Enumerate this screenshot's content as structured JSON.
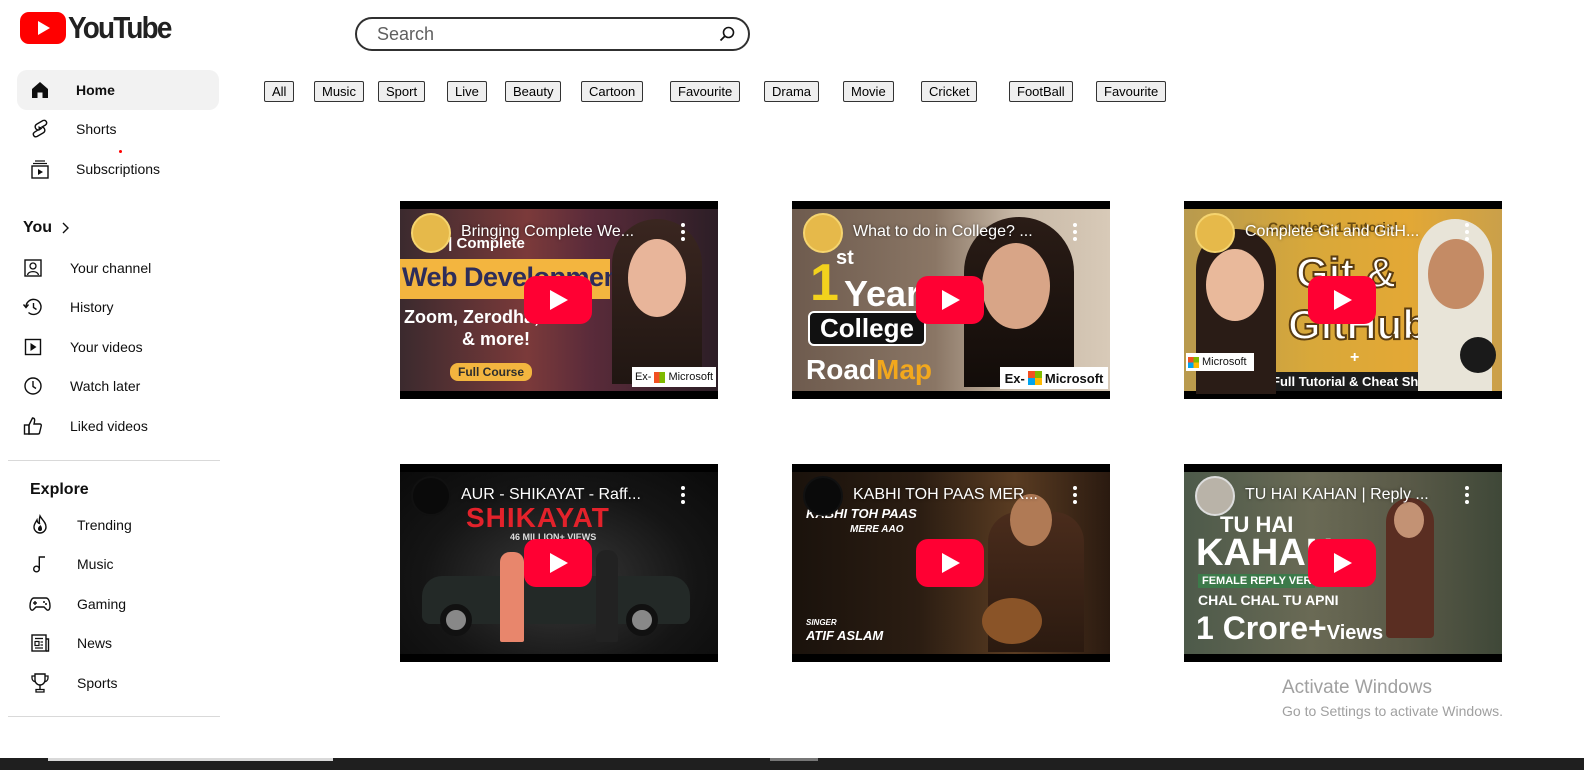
{
  "brand": {
    "name": "YouTube",
    "logo_color": "#ff0000"
  },
  "search": {
    "placeholder": "Search",
    "value": ""
  },
  "sidebar": {
    "main": [
      {
        "label": "Home",
        "icon": "home-icon",
        "active": true
      },
      {
        "label": "Shorts",
        "icon": "shorts-icon"
      },
      {
        "label": "Subscriptions",
        "icon": "subscriptions-icon"
      }
    ],
    "you_label": "You",
    "you_items": [
      {
        "label": "Your channel",
        "icon": "channel-icon"
      },
      {
        "label": "History",
        "icon": "history-icon"
      },
      {
        "label": "Your videos",
        "icon": "your-videos-icon"
      },
      {
        "label": "Watch later",
        "icon": "watch-later-icon"
      },
      {
        "label": "Liked videos",
        "icon": "liked-icon"
      }
    ],
    "explore_label": "Explore",
    "explore_items": [
      {
        "label": "Trending",
        "icon": "trending-icon"
      },
      {
        "label": "Music",
        "icon": "music-icon"
      },
      {
        "label": "Gaming",
        "icon": "gaming-icon"
      },
      {
        "label": "News",
        "icon": "news-icon"
      },
      {
        "label": "Sports",
        "icon": "trophy-icon"
      }
    ]
  },
  "chips": [
    "All",
    "Music",
    "Sport",
    "Live",
    "Beauty",
    "Cartoon",
    "Favourite",
    "Drama",
    "Movie",
    "Cricket",
    "FootBall",
    "Favourite"
  ],
  "videos": [
    {
      "title": "Bringing Complete We...",
      "overlay": [
        "ew | Complete",
        "Web Development",
        "Zoom, Zerodha,",
        "& more!",
        "Full Course",
        "Ex-",
        "Microsoft"
      ]
    },
    {
      "title": "What to do in College? ...",
      "overlay": [
        "1",
        "st",
        "Year",
        "College",
        "Road",
        "Map",
        "Ex-",
        "Microsoft"
      ]
    },
    {
      "title": "Complete Git and GitH...",
      "overlay": [
        "Complete 1 Tutorial",
        "Git &",
        "GitHub",
        "+",
        "Full Tutorial & Cheat Sheet",
        "Microsoft"
      ]
    },
    {
      "title": "AUR - SHIKAYAT - Raff...",
      "overlay": [
        "SHIKAYAT",
        "46 MILLION+ VIEWS"
      ]
    },
    {
      "title": "KABHI TOH PAAS MER...",
      "overlay": [
        "KABHI TOH PAAS",
        "MERE AAO",
        "SINGER",
        "ATIF ASLAM"
      ]
    },
    {
      "title": "TU HAI KAHAN | Reply ...",
      "overlay": [
        "TU HAI",
        "KAHAN",
        "FEMALE REPLY VER",
        "CHAL CHAL TU APNI",
        "1 Crore+",
        "Views"
      ]
    }
  ],
  "watermark": {
    "line1": "Activate Windows",
    "line2": "Go to Settings to activate Windows."
  }
}
